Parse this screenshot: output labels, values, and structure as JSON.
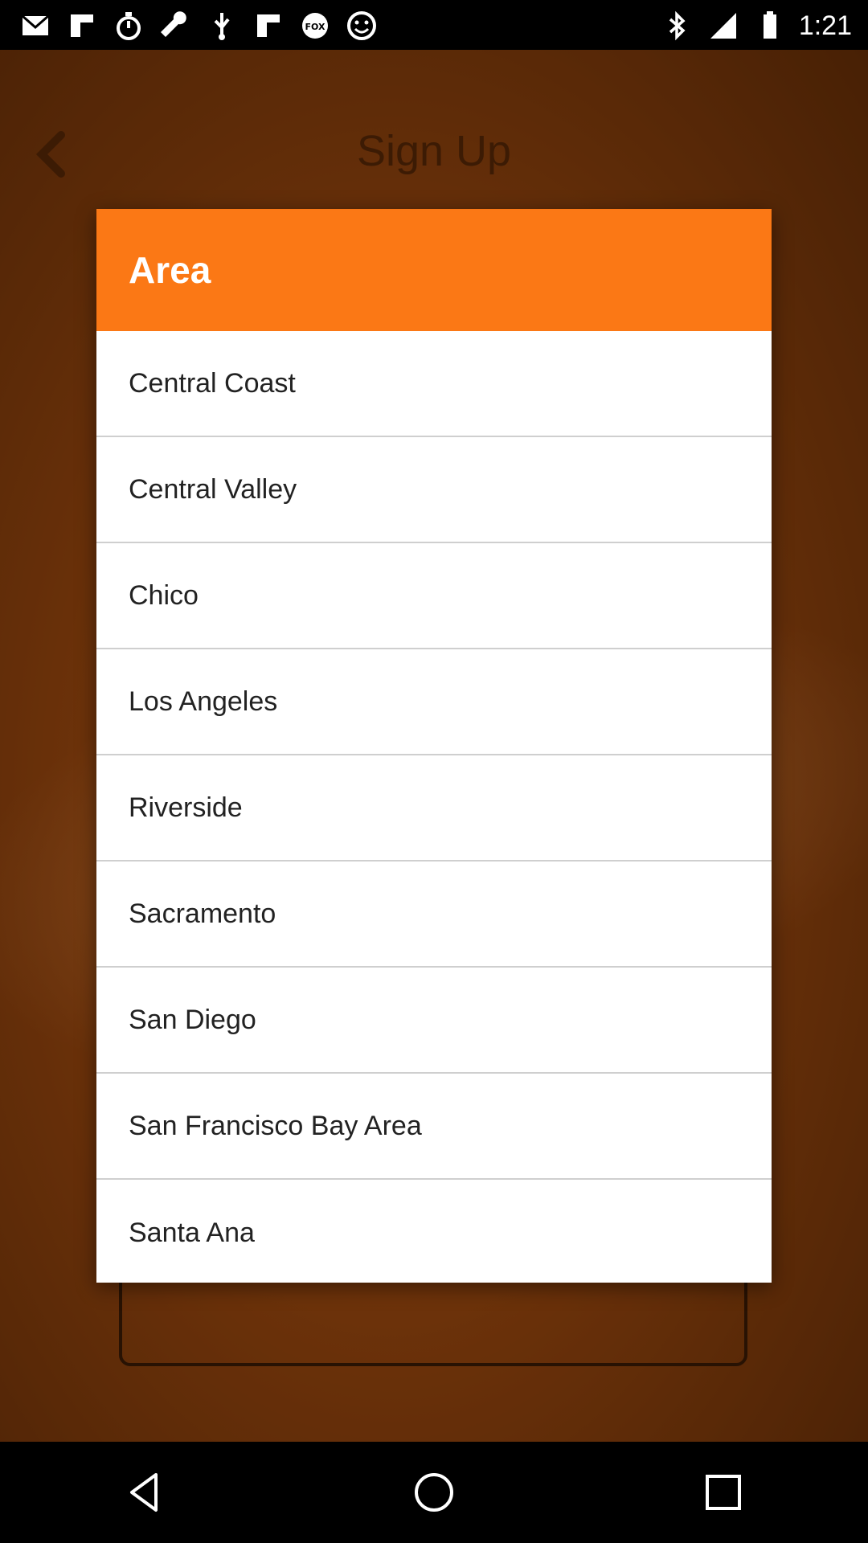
{
  "status_bar": {
    "time": "1:21",
    "icons": [
      "email-icon",
      "flipboard-icon",
      "stopwatch-icon",
      "wrench-icon",
      "usb-icon",
      "flipboard-icon",
      "fox-sports-icon",
      "smiley-icon"
    ],
    "right_icons": [
      "bluetooth-icon",
      "signal-icon",
      "battery-icon"
    ]
  },
  "background_app": {
    "title": "Sign Up",
    "back_icon": "chevron-left-icon"
  },
  "dialog": {
    "title": "Area",
    "options": [
      "Central Coast",
      "Central Valley",
      "Chico",
      "Los Angeles",
      "Riverside",
      "Sacramento",
      "San Diego",
      "San Francisco Bay Area",
      "Santa Ana"
    ]
  },
  "nav_bar": {
    "buttons": [
      "back-icon",
      "home-icon",
      "recents-icon"
    ]
  },
  "colors": {
    "accent": "#fb7815",
    "background_app": "#a84e10"
  }
}
